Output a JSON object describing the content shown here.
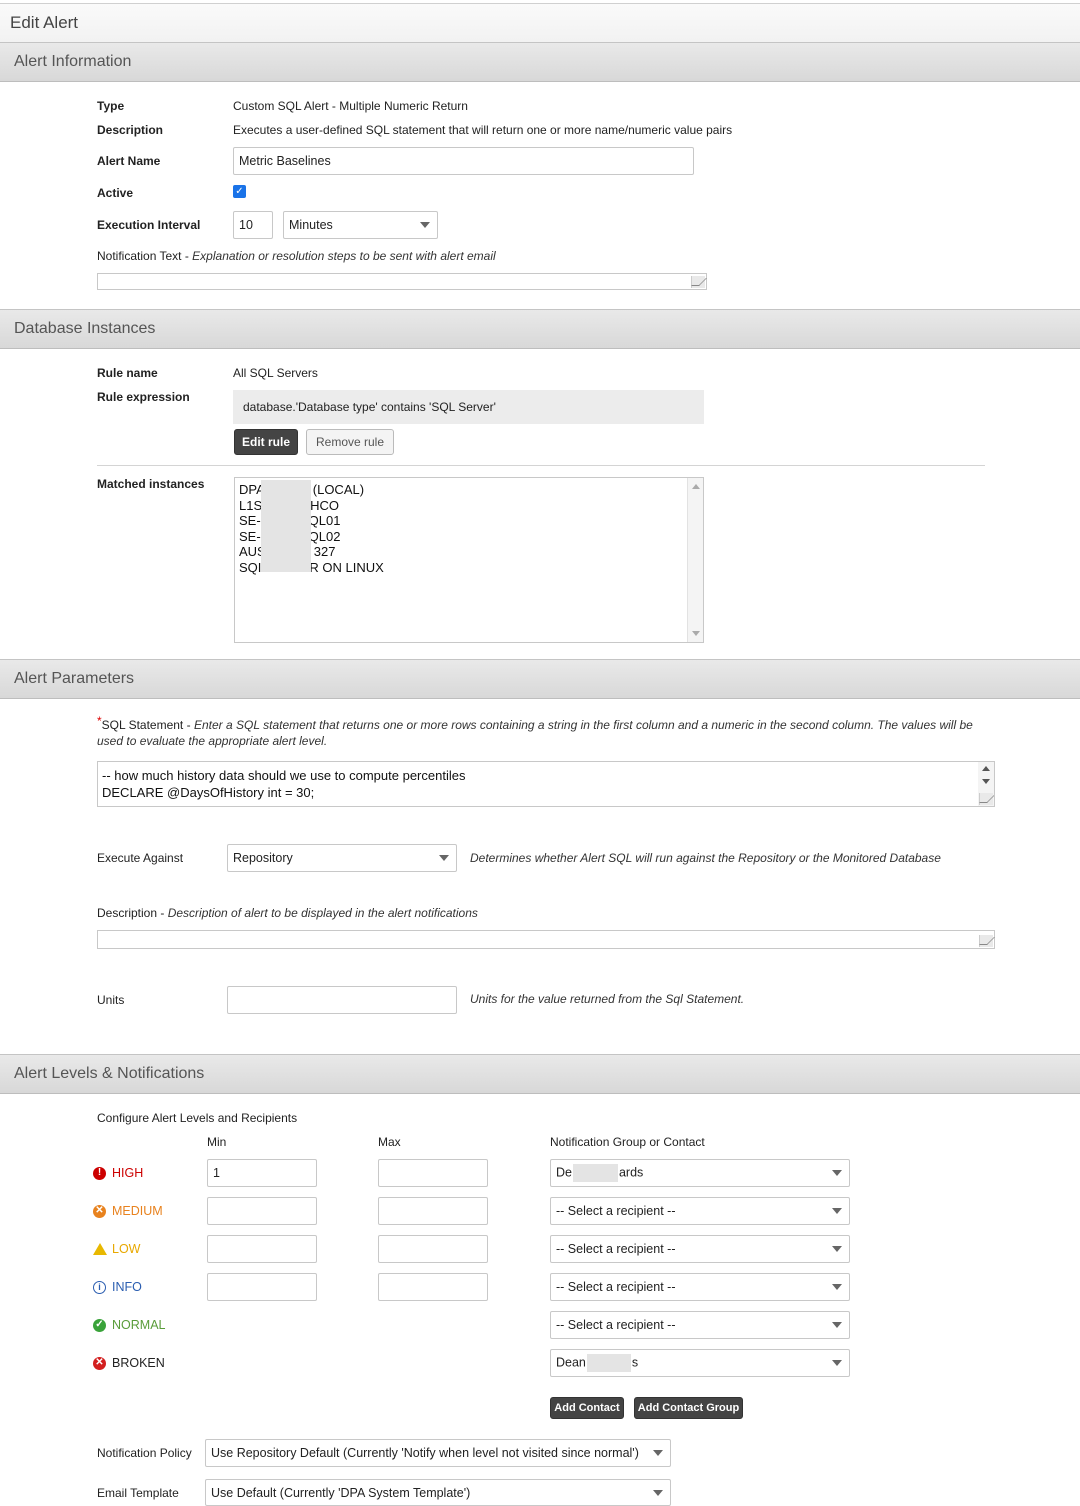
{
  "page_title": "Edit Alert",
  "sections": {
    "info": "Alert Information",
    "db": "Database Instances",
    "params": "Alert Parameters",
    "levels": "Alert Levels & Notifications"
  },
  "info": {
    "type_label": "Type",
    "type_value": "Custom SQL Alert - Multiple Numeric Return",
    "desc_label": "Description",
    "desc_value": "Executes a user-defined SQL statement that will return one or more name/numeric value pairs",
    "name_label": "Alert Name",
    "name_value": "Metric Baselines",
    "active_label": "Active",
    "active_checked": true,
    "interval_label": "Execution Interval",
    "interval_value": "10",
    "interval_unit": "Minutes",
    "notif_label": "Notification Text",
    "notif_hint": "Explanation or resolution steps to be sent with alert email",
    "notif_sep": " - "
  },
  "db": {
    "rule_name_label": "Rule name",
    "rule_name_value": "All SQL Servers",
    "rule_expr_label": "Rule expression",
    "rule_expr_value": "database.'Database type' contains 'SQL Server'",
    "edit_rule": "Edit rule",
    "remove_rule": "Remove rule",
    "matched_label": "Matched instances",
    "instances": [
      {
        "pre": "DPA",
        "post": "(LOCAL)"
      },
      {
        "pre": "L1S",
        "post": "HCO"
      },
      {
        "pre": "SE-",
        "post": "QL01"
      },
      {
        "pre": "SE-",
        "post": "QL02"
      },
      {
        "pre": "AUS",
        "post": "327"
      },
      {
        "pre": "SQI",
        "post": "R ON LINUX"
      }
    ]
  },
  "params": {
    "req_mark": "*",
    "sql_label": "SQL Statement",
    "sql_sep": " - ",
    "sql_hint": "Enter a SQL statement that returns one or more rows containing a string in the first column and a numeric in the second column. The values will be used to evaluate the appropriate alert level.",
    "sql_lines": [
      "-- how much history data should we use to compute percentiles",
      "DECLARE @DaysOfHistory int = 30;"
    ],
    "exec_label": "Execute Against",
    "exec_value": "Repository",
    "exec_hint": "Determines whether Alert SQL will run against the Repository or the Monitored Database",
    "desc_label": "Description",
    "desc_sep": " - ",
    "desc_hint": "Description of alert to be displayed in the alert notifications",
    "units_label": "Units",
    "units_value": "",
    "units_hint": "Units for the value returned from the Sql Statement."
  },
  "levels": {
    "configure_label": "Configure Alert Levels and Recipients",
    "min_header": "Min",
    "max_header": "Max",
    "recipient_header": "Notification Group or Contact",
    "rows": [
      {
        "name": "HIGH",
        "color": "#cc0000",
        "icon": "exclamation-circle-icon",
        "min": "1",
        "max": "",
        "recipient": "De",
        "recipient_post": "ards",
        "has_range": true
      },
      {
        "name": "MEDIUM",
        "color": "#e8821e",
        "icon": "x-circle-orange-icon",
        "min": "",
        "max": "",
        "recipient": "-- Select a recipient --",
        "recipient_post": "",
        "has_range": true
      },
      {
        "name": "LOW",
        "color": "#e8a800",
        "icon": "warning-triangle-icon",
        "min": "",
        "max": "",
        "recipient": "-- Select a recipient --",
        "recipient_post": "",
        "has_range": true
      },
      {
        "name": "INFO",
        "color": "#2a5db0",
        "icon": "info-circle-icon",
        "min": "",
        "max": "",
        "recipient": "-- Select a recipient --",
        "recipient_post": "",
        "has_range": true
      },
      {
        "name": "NORMAL",
        "color": "#5a9c3a",
        "icon": "check-circle-icon",
        "recipient": "-- Select a recipient --",
        "recipient_post": "",
        "has_range": false
      },
      {
        "name": "BROKEN",
        "color": "#222222",
        "icon": "x-circle-red-icon",
        "recipient": "Dean",
        "recipient_post": "s",
        "has_range": false
      }
    ],
    "add_contact": "Add Contact",
    "add_group": "Add Contact Group",
    "policy_label": "Notification Policy",
    "policy_value": "Use Repository Default (Currently 'Notify when level not visited since normal')",
    "template_label": "Email Template",
    "template_value": "Use Default (Currently 'DPA System Template')"
  }
}
